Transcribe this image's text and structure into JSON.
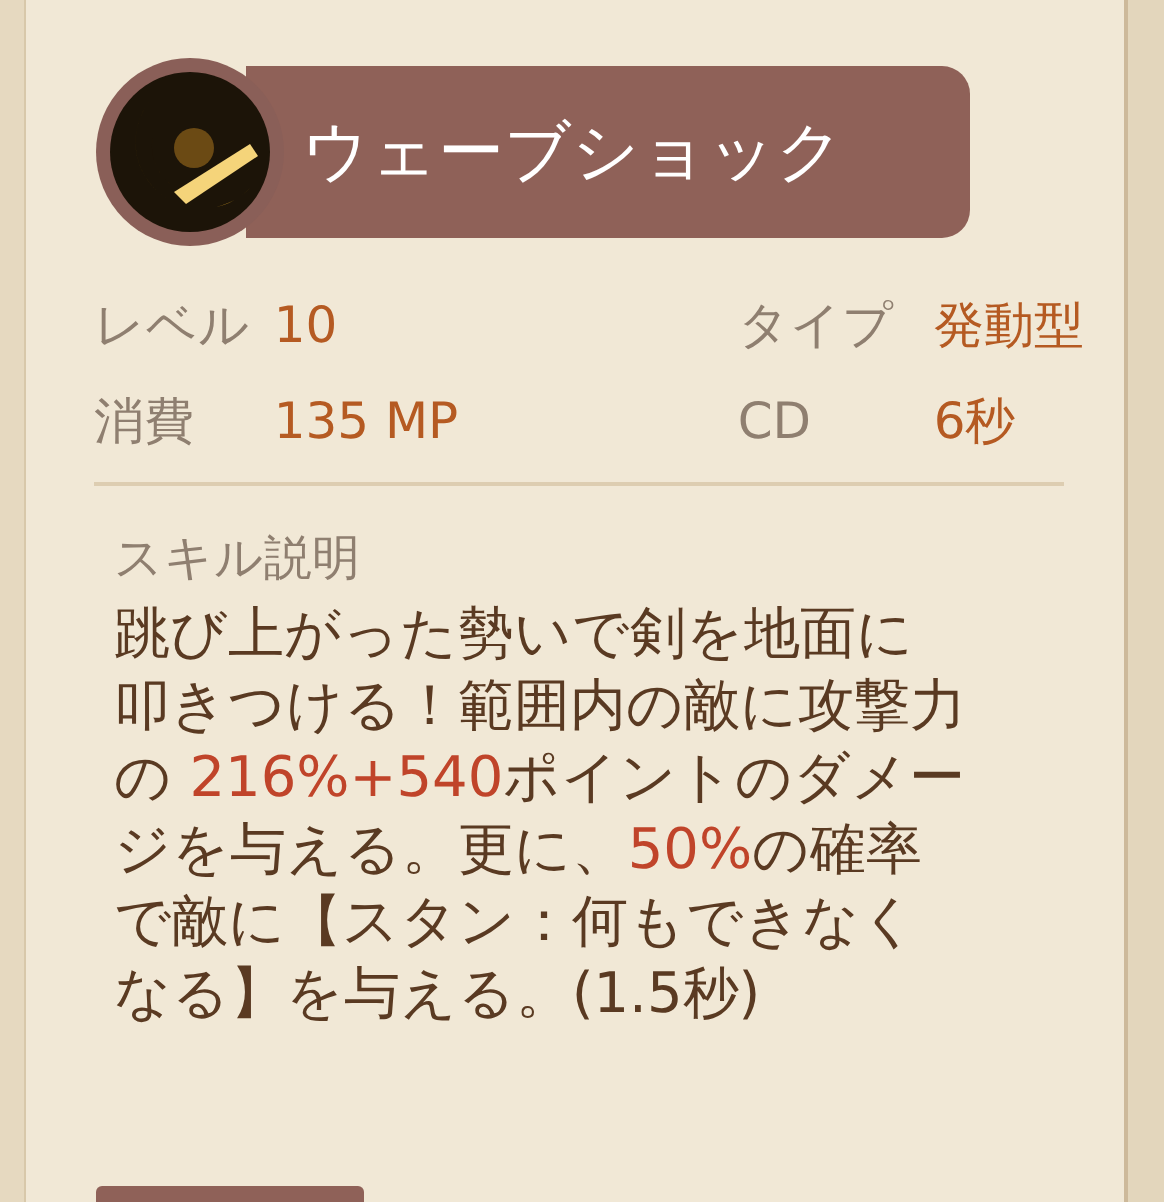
{
  "skill": {
    "name": "ウェーブショック"
  },
  "stats": [
    {
      "label": "レベル",
      "value": "10"
    },
    {
      "label": "タイプ",
      "value": "発動型"
    },
    {
      "label": "消費",
      "value": "135 MP"
    },
    {
      "label": "CD",
      "value": "6秒"
    }
  ],
  "description": {
    "heading": "スキル説明",
    "segments": [
      {
        "text": "跳び上がった勢いで剣を地面に叩きつける！範囲内の敵に攻撃力の ",
        "highlight": false
      },
      {
        "text": "216%+540",
        "highlight": true
      },
      {
        "text": "ポイントのダメージを与える。更に、",
        "highlight": false
      },
      {
        "text": "50%",
        "highlight": true
      },
      {
        "text": "の確率で敵に【スタン：何もできなくなる】を与える。(1.5秒)",
        "highlight": false
      }
    ]
  }
}
